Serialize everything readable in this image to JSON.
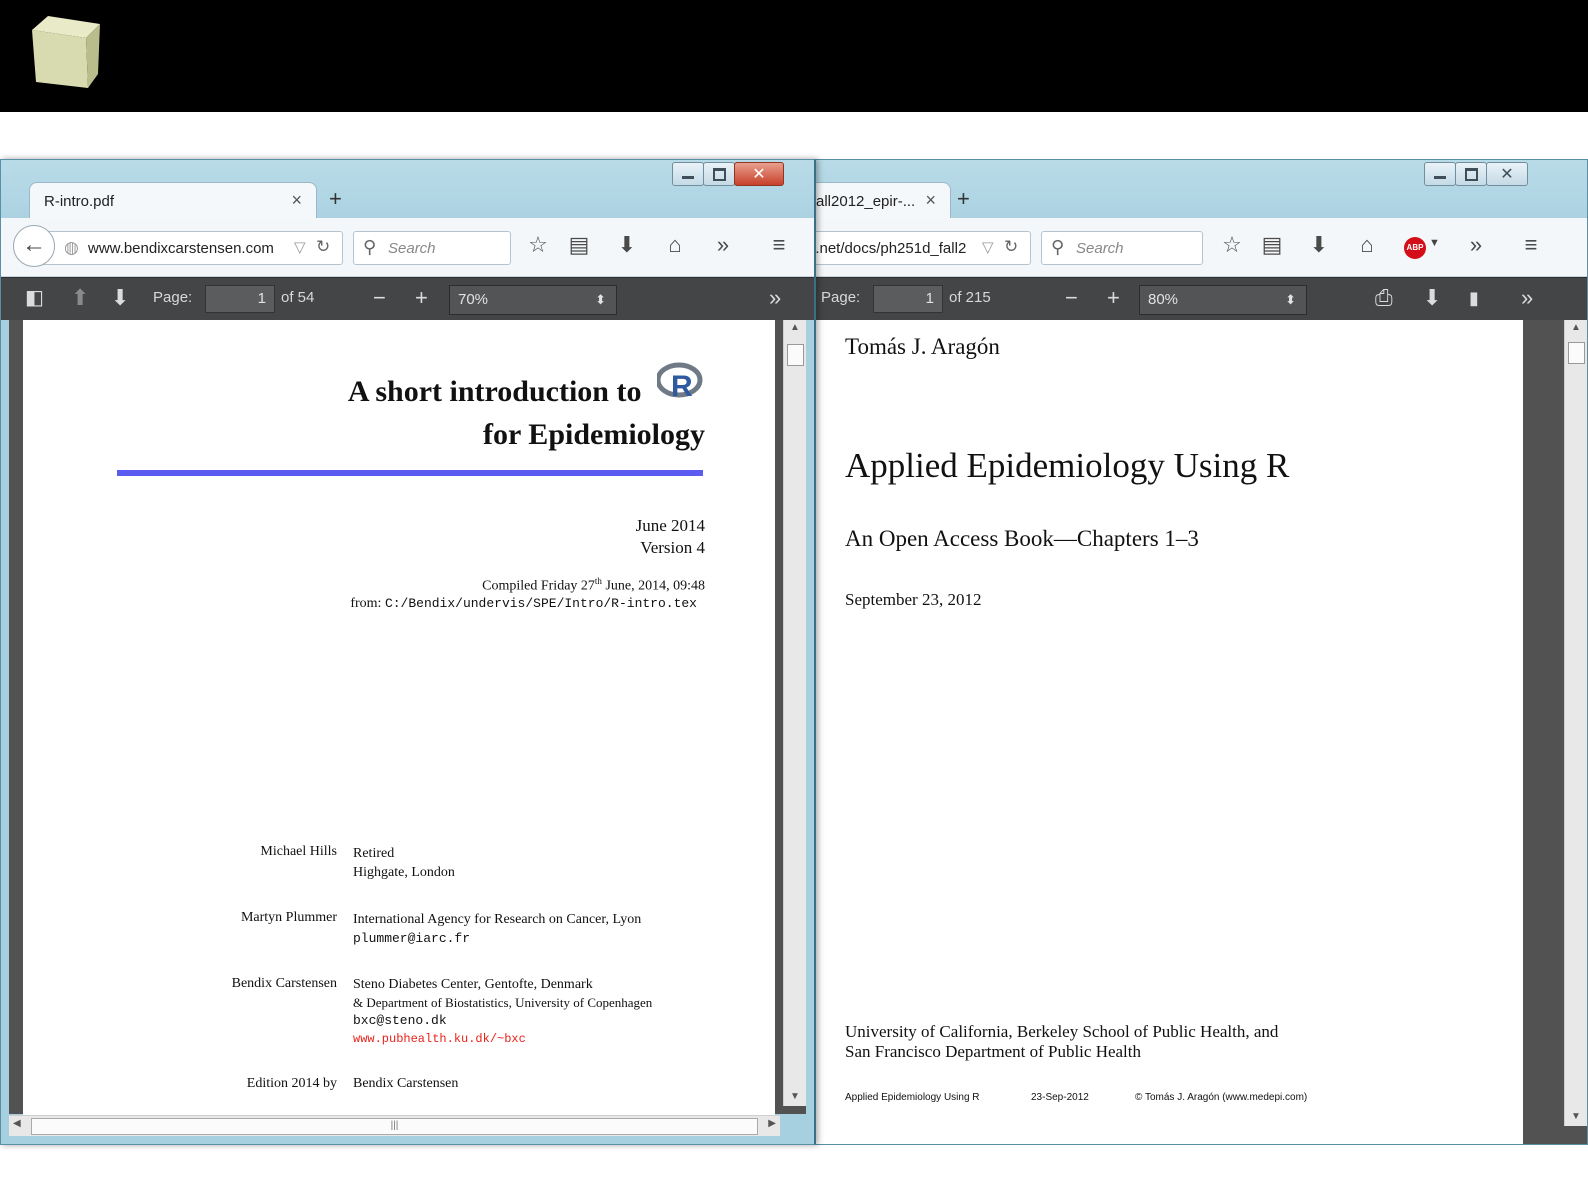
{
  "left_window": {
    "tab_title": "R-intro.pdf",
    "url_domain": "www.bendixcarstensen.com",
    "search_placeholder": "Search",
    "pdf_toolbar": {
      "page_label": "Page:",
      "page_value": "1",
      "page_total": "of 54",
      "zoom": "70%"
    },
    "document": {
      "title_line1": "A short introduction to",
      "title_line2": "for Epidemiology",
      "date": "June 2014",
      "version": "Version 4",
      "compiled_prefix": "Compiled Friday 27",
      "compiled_sup": "th",
      "compiled_suffix": " June, 2014, 09:48",
      "from_label": "from:",
      "from_path": "C:/Bendix/undervis/SPE/Intro/R-intro.tex",
      "authors": [
        {
          "name": "Michael Hills",
          "lines": [
            "Retired",
            "Highgate, London"
          ]
        },
        {
          "name": "Martyn Plummer",
          "lines": [
            "International Agency for Research on Cancer, Lyon"
          ],
          "email": "plummer@iarc.fr"
        },
        {
          "name": "Bendix Carstensen",
          "lines": [
            "Steno Diabetes Center, Gentofte, Denmark",
            "& Department of Biostatistics, University of Copenhagen"
          ],
          "email": "bxc@steno.dk",
          "web": "www.pubhealth.ku.dk/~bxc"
        }
      ],
      "edition_label": "Edition 2014 by",
      "edition_value": "Bendix Carstensen"
    }
  },
  "right_window": {
    "tab_title": "all2012_epir-...",
    "url_text": "i.net/docs/ph251d_fall2",
    "search_placeholder": "Search",
    "pdf_toolbar": {
      "page_label": "Page:",
      "page_value": "1",
      "page_total": "of 215",
      "zoom": "80%"
    },
    "document": {
      "author": "Tomás J. Aragón",
      "title": "Applied Epidemiology Using R",
      "subtitle": "An Open Access Book—Chapters 1–3",
      "date": "September 23, 2012",
      "affiliation_line1": "University of California, Berkeley School of Public Health, and",
      "affiliation_line2": "San Francisco Department of Public Health",
      "footer_title": "Applied Epidemiology Using R",
      "footer_date": "23-Sep-2012",
      "footer_copyright": "© Tomás J. Aragón (www.medepi.com)"
    }
  },
  "icons": {
    "back": "←",
    "reload": "C",
    "star": "☆",
    "home": "⌂",
    "download": "⬇",
    "menu": "≡",
    "overflow": "»",
    "minus": "−",
    "plus": "+",
    "up": "⬆",
    "down": "⬇",
    "print": "⎙",
    "bookmark": "▮",
    "sidebar": "◧"
  }
}
